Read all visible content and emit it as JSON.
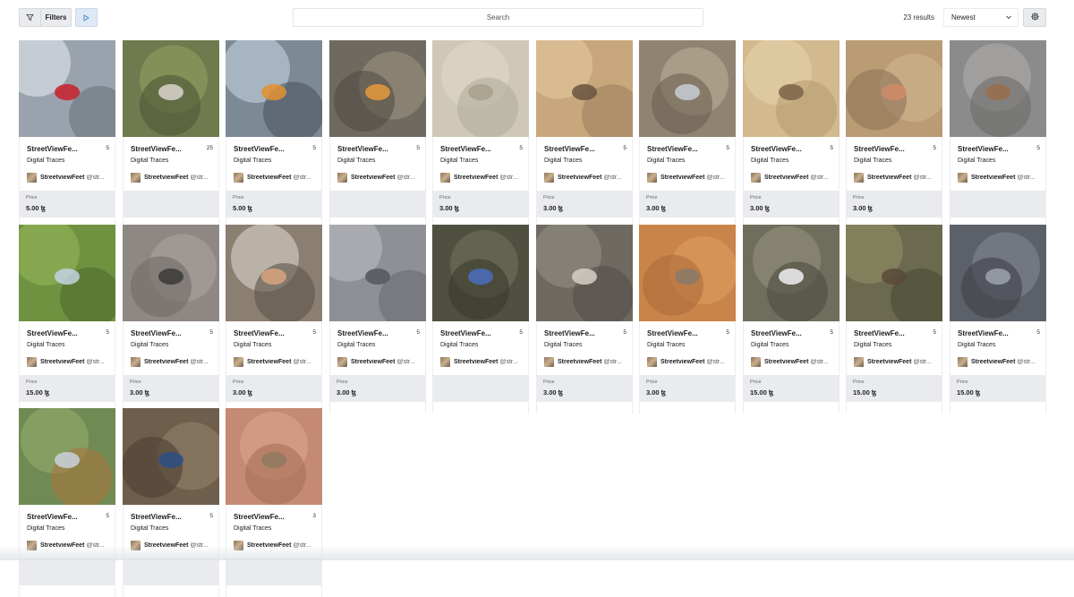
{
  "toolbar": {
    "filters_label": "Filters",
    "search_placeholder": "Search",
    "results_text": "23 results",
    "sort_selected": "Newest",
    "icons": {
      "filter": "filter-icon",
      "play": "play-icon",
      "chevron": "chevron-down-icon",
      "settings": "gear-icon"
    },
    "accent_color": "#3b82c4"
  },
  "card_common": {
    "price_label": "Price"
  },
  "items": [
    {
      "title": "StreetViewFe...",
      "count": "5",
      "collection": "Digital Traces",
      "user": "StreetviewFeet",
      "handle": "@str...",
      "price": "5.00 ꜩ",
      "colors": [
        "#9aa3ad",
        "#d8dde2",
        "#6c747c"
      ],
      "accent": "#c8202a"
    },
    {
      "title": "StreetViewFe...",
      "count": "25",
      "collection": "Digital Traces",
      "user": "StreetviewFeet",
      "handle": "@str...",
      "price": "",
      "colors": [
        "#6f7a4f",
        "#8b9a5c",
        "#4f5637"
      ],
      "accent": "#d9d4cc"
    },
    {
      "title": "StreetViewFe...",
      "count": "5",
      "collection": "Digital Traces",
      "user": "StreetviewFeet",
      "handle": "@str...",
      "price": "5.00 ꜩ",
      "colors": [
        "#7c8a96",
        "#b9c7d6",
        "#4d5560"
      ],
      "accent": "#e3902f"
    },
    {
      "title": "StreetViewFe...",
      "count": "5",
      "collection": "Digital Traces",
      "user": "StreetviewFeet",
      "handle": "@str...",
      "price": "",
      "colors": [
        "#6e6a5f",
        "#948d7c",
        "#514d44"
      ],
      "accent": "#e89a3a"
    },
    {
      "title": "StreetViewFe...",
      "count": "5",
      "collection": "Digital Traces",
      "user": "StreetviewFeet",
      "handle": "@str...",
      "price": "3.00 ꜩ",
      "colors": [
        "#cfc8b6",
        "#ddd6c5",
        "#b3ad9c"
      ],
      "accent": "#a89f8c"
    },
    {
      "title": "StreetViewFe...",
      "count": "5",
      "collection": "Digital Traces",
      "user": "StreetviewFeet",
      "handle": "@str...",
      "price": "3.00 ꜩ",
      "colors": [
        "#c9a77c",
        "#dfc39b",
        "#9c8061"
      ],
      "accent": "#6a5240"
    },
    {
      "title": "StreetViewFe...",
      "count": "5",
      "collection": "Digital Traces",
      "user": "StreetviewFeet",
      "handle": "@str...",
      "price": "3.00 ꜩ",
      "colors": [
        "#8f8372",
        "#b5a892",
        "#6c6253"
      ],
      "accent": "#c7ced6"
    },
    {
      "title": "StreetViewFe...",
      "count": "5",
      "collection": "Digital Traces",
      "user": "StreetviewFeet",
      "handle": "@str...",
      "price": "3.00 ꜩ",
      "colors": [
        "#d3b98e",
        "#e3cfa8",
        "#b89c71"
      ],
      "accent": "#7d6346"
    },
    {
      "title": "StreetViewFe...",
      "count": "5",
      "collection": "Digital Traces",
      "user": "StreetviewFeet",
      "handle": "@str...",
      "price": "3.00 ꜩ",
      "colors": [
        "#b99b74",
        "#cdb28d",
        "#8e7457"
      ],
      "accent": "#d08a69"
    },
    {
      "title": "StreetViewFe...",
      "count": "5",
      "collection": "Digital Traces",
      "user": "StreetviewFeet",
      "handle": "@str...",
      "price": "",
      "colors": [
        "#8b8b8b",
        "#a9a8a6",
        "#6d6c6a"
      ],
      "accent": "#9a6d4a"
    },
    {
      "title": "StreetViewFe...",
      "count": "5",
      "collection": "Digital Traces",
      "user": "StreetviewFeet",
      "handle": "@str...",
      "price": "15.00 ꜩ",
      "colors": [
        "#6f9241",
        "#8db155",
        "#4f6a2c"
      ],
      "accent": "#c2d3e3"
    },
    {
      "title": "StreetViewFe...",
      "count": "5",
      "collection": "Digital Traces",
      "user": "StreetviewFeet",
      "handle": "@str...",
      "price": "3.00 ꜩ",
      "colors": [
        "#8e8783",
        "#a7a09c",
        "#716b67"
      ],
      "accent": "#3c3a39"
    },
    {
      "title": "StreetViewFe...",
      "count": "5",
      "collection": "Digital Traces",
      "user": "StreetviewFeet",
      "handle": "@str...",
      "price": "3.00 ꜩ",
      "colors": [
        "#8b7f72",
        "#cfc7bc",
        "#5e544a"
      ],
      "accent": "#d8a37e"
    },
    {
      "title": "StreetViewFe...",
      "count": "5",
      "collection": "Digital Traces",
      "user": "StreetviewFeet",
      "handle": "@str...",
      "price": "3.00 ꜩ",
      "colors": [
        "#8e9096",
        "#b3b5b9",
        "#6b6d72"
      ],
      "accent": "#55575c"
    },
    {
      "title": "StreetViewFe...",
      "count": "5",
      "collection": "Digital Traces",
      "user": "StreetviewFeet",
      "handle": "@str...",
      "price": "",
      "colors": [
        "#4f5040",
        "#6c6c56",
        "#3a3a2f"
      ],
      "accent": "#4b6dbf"
    },
    {
      "title": "StreetViewFe...",
      "count": "5",
      "collection": "Digital Traces",
      "user": "StreetviewFeet",
      "handle": "@str...",
      "price": "3.00 ꜩ",
      "colors": [
        "#6e6a62",
        "#8f8a80",
        "#534f49"
      ],
      "accent": "#d6d0c6"
    },
    {
      "title": "StreetViewFe...",
      "count": "5",
      "collection": "Digital Traces",
      "user": "StreetviewFeet",
      "handle": "@str...",
      "price": "3.00 ꜩ",
      "colors": [
        "#c9844a",
        "#dc9a5c",
        "#ab6d38"
      ],
      "accent": "#8a7a68"
    },
    {
      "title": "StreetViewFe...",
      "count": "5",
      "collection": "Digital Traces",
      "user": "StreetviewFeet",
      "handle": "@str...",
      "price": "15.00 ꜩ",
      "colors": [
        "#6f6e5d",
        "#8e8c78",
        "#4c4b3f"
      ],
      "accent": "#eef0f2"
    },
    {
      "title": "StreetViewFe...",
      "count": "5",
      "collection": "Digital Traces",
      "user": "StreetviewFeet",
      "handle": "@str...",
      "price": "15.00 ꜩ",
      "colors": [
        "#6b6a4e",
        "#8b8964",
        "#4a4936"
      ],
      "accent": "#5a4a3a"
    },
    {
      "title": "StreetViewFe...",
      "count": "5",
      "collection": "Digital Traces",
      "user": "StreetviewFeet",
      "handle": "@str...",
      "price": "15.00 ꜩ",
      "colors": [
        "#5c6068",
        "#7d828a",
        "#3e4148"
      ],
      "accent": "#9ea3aa"
    },
    {
      "title": "StreetViewFe...",
      "count": "5",
      "collection": "Digital Traces",
      "user": "StreetviewFeet",
      "handle": "@str...",
      "price": "",
      "colors": [
        "#6f8a52",
        "#8ea66a",
        "#a8763f"
      ],
      "accent": "#c7d2dc"
    },
    {
      "title": "StreetViewFe...",
      "count": "5",
      "collection": "Digital Traces",
      "user": "StreetviewFeet",
      "handle": "@str...",
      "price": "",
      "colors": [
        "#6e5e4c",
        "#8c7a64",
        "#4c4032"
      ],
      "accent": "#2e4f86"
    },
    {
      "title": "StreetViewFe...",
      "count": "3",
      "collection": "Digital Traces",
      "user": "StreetviewFeet",
      "handle": "@str...",
      "price": "",
      "colors": [
        "#c48a73",
        "#d9a08a",
        "#a87058"
      ],
      "accent": "#8d7a62"
    }
  ]
}
